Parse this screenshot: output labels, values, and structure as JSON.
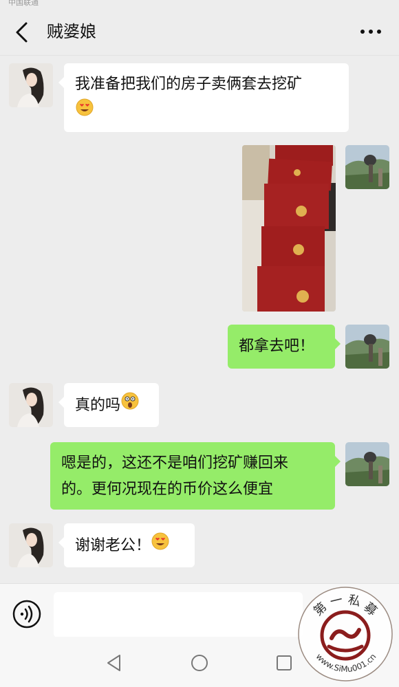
{
  "status_bar": {
    "text": "中国联通"
  },
  "header": {
    "title": "贼婆娘"
  },
  "messages": [
    {
      "side": "left",
      "text": "我准备把我们的房子卖俩套去挖矿",
      "emoji": "heart-eyes-emoji"
    },
    {
      "side": "right",
      "type": "photo"
    },
    {
      "side": "right",
      "text": "都拿去吧！"
    },
    {
      "side": "left",
      "text": "真的吗",
      "emoji": "shocked-emoji"
    },
    {
      "side": "right",
      "line1": "嗯是的，这还不是咱们挖矿赚回来",
      "line2": "的。更何况现在的币价这么便宜"
    },
    {
      "side": "left",
      "text": "谢谢老公！",
      "emoji": "heart-eyes-emoji"
    }
  ],
  "input": {
    "value": "",
    "placeholder": ""
  },
  "watermark": {
    "top_text": "第一私募",
    "bottom_text": "www.SiMu001.cn"
  },
  "colors": {
    "background": "#ededed",
    "sent_bubble": "#95ec69",
    "received_bubble": "#ffffff"
  }
}
